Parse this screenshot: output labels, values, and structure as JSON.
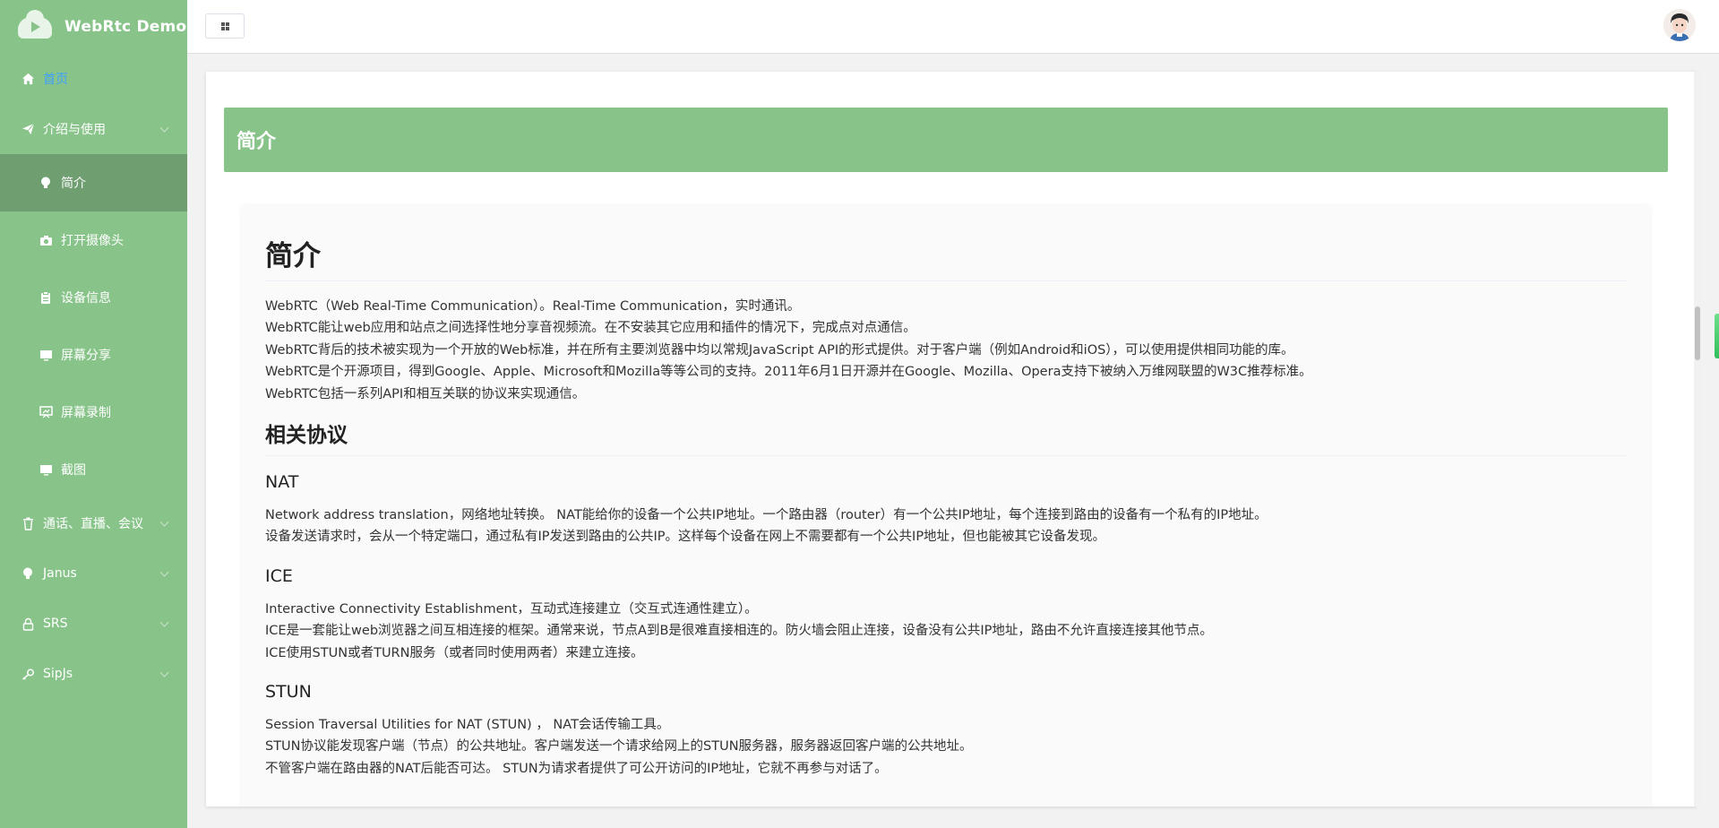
{
  "brand": {
    "title": "WebRtc Demo"
  },
  "sidebar": {
    "items": [
      {
        "label": "首页",
        "icon": "home-icon"
      },
      {
        "label": "介绍与使用",
        "icon": "paper-plane-icon"
      },
      {
        "label": "简介",
        "icon": "bulb-icon"
      },
      {
        "label": "打开摄像头",
        "icon": "camera-icon"
      },
      {
        "label": "设备信息",
        "icon": "clipboard-icon"
      },
      {
        "label": "屏幕分享",
        "icon": "monitor-icon"
      },
      {
        "label": "屏幕录制",
        "icon": "present-icon"
      },
      {
        "label": "截图",
        "icon": "monitor-icon"
      },
      {
        "label": "通话、直播、会议",
        "icon": "trash-icon"
      },
      {
        "label": "Janus",
        "icon": "bulb-icon"
      },
      {
        "label": "SRS",
        "icon": "lock-icon"
      },
      {
        "label": "SipJs",
        "icon": "key-icon"
      }
    ]
  },
  "header": {
    "avatar_alt": "avatar"
  },
  "main": {
    "banner_title": "简介",
    "article": {
      "h1": "简介",
      "intro": [
        "WebRTC（Web Real-Time Communication）。Real-Time Communication，实时通讯。",
        "WebRTC能让web应用和站点之间选择性地分享音视频流。在不安装其它应用和插件的情况下，完成点对点通信。",
        "WebRTC背后的技术被实现为一个开放的Web标准，并在所有主要浏览器中均以常规JavaScript API的形式提供。对于客户端（例如Android和iOS），可以使用提供相同功能的库。",
        "WebRTC是个开源项目，得到Google、Apple、Microsoft和Mozilla等等公司的支持。2011年6月1日开源并在Google、Mozilla、Opera支持下被纳入万维网联盟的W3C推荐标准。",
        "WebRTC包括一系列API和相互关联的协议来实现通信。"
      ],
      "h2": "相关协议",
      "nat": {
        "title": "NAT",
        "lines": [
          "Network address translation，网络地址转换。 NAT能给你的设备一个公共IP地址。一个路由器（router）有一个公共IP地址，每个连接到路由的设备有一个私有的IP地址。",
          "设备发送请求时，会从一个特定端口，通过私有IP发送到路由的公共IP。这样每个设备在网上不需要都有一个公共IP地址，但也能被其它设备发现。"
        ]
      },
      "ice": {
        "title": "ICE",
        "lines": [
          "Interactive Connectivity Establishment，互动式连接建立（交互式连通性建立）。",
          "ICE是一套能让web浏览器之间互相连接的框架。通常来说，节点A到B是很难直接相连的。防火墙会阻止连接，设备没有公共IP地址，路由不允许直接连接其他节点。",
          "ICE使用STUN或者TURN服务（或者同时使用两者）来建立连接。"
        ]
      },
      "stun": {
        "title": "STUN",
        "lines": [
          "Session Traversal Utilities for NAT (STUN) ， NAT会话传输工具。",
          "STUN协议能发现客户端（节点）的公共地址。客户端发送一个请求给网上的STUN服务器，服务器返回客户端的公共地址。",
          "不管客户端在路由器的NAT后能否可达。 STUN为请求者提供了可公开访问的IP地址，它就不再参与对话了。"
        ]
      }
    }
  }
}
